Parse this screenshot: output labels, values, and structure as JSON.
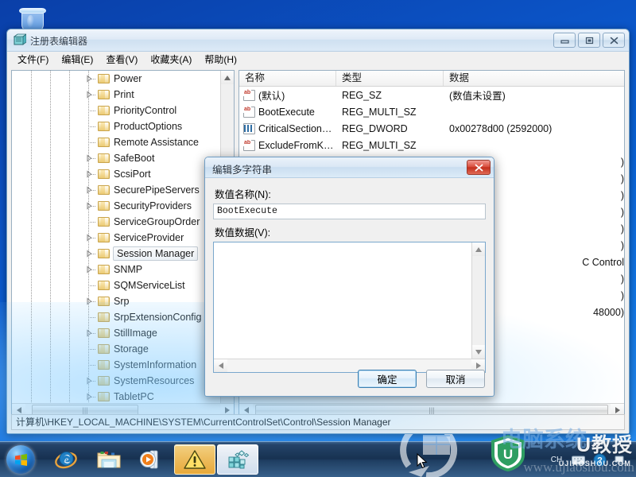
{
  "window": {
    "title": "注册表编辑器",
    "icon": "registry-editor-icon",
    "minimize_label": "最小化",
    "maximize_label": "最大化",
    "close_label": "关闭"
  },
  "menubar": {
    "items": [
      {
        "label": "文件(F)",
        "name": "menu-file"
      },
      {
        "label": "编辑(E)",
        "name": "menu-edit"
      },
      {
        "label": "查看(V)",
        "name": "menu-view"
      },
      {
        "label": "收藏夹(A)",
        "name": "menu-favorites"
      },
      {
        "label": "帮助(H)",
        "name": "menu-help"
      }
    ]
  },
  "tree": {
    "items": [
      {
        "label": "Power",
        "expandable": true,
        "selected": false
      },
      {
        "label": "Print",
        "expandable": true,
        "selected": false
      },
      {
        "label": "PriorityControl",
        "expandable": false,
        "selected": false
      },
      {
        "label": "ProductOptions",
        "expandable": false,
        "selected": false
      },
      {
        "label": "Remote Assistance",
        "expandable": false,
        "selected": false
      },
      {
        "label": "SafeBoot",
        "expandable": true,
        "selected": false
      },
      {
        "label": "ScsiPort",
        "expandable": true,
        "selected": false
      },
      {
        "label": "SecurePipeServers",
        "expandable": true,
        "selected": false
      },
      {
        "label": "SecurityProviders",
        "expandable": true,
        "selected": false
      },
      {
        "label": "ServiceGroupOrder",
        "expandable": false,
        "selected": false
      },
      {
        "label": "ServiceProvider",
        "expandable": true,
        "selected": false
      },
      {
        "label": "Session Manager",
        "expandable": true,
        "selected": true
      },
      {
        "label": "SNMP",
        "expandable": true,
        "selected": false
      },
      {
        "label": "SQMServiceList",
        "expandable": false,
        "selected": false
      },
      {
        "label": "Srp",
        "expandable": true,
        "selected": false
      },
      {
        "label": "SrpExtensionConfig",
        "expandable": false,
        "selected": false
      },
      {
        "label": "StillImage",
        "expandable": true,
        "selected": false
      },
      {
        "label": "Storage",
        "expandable": false,
        "selected": false
      },
      {
        "label": "SystemInformation",
        "expandable": false,
        "selected": false
      },
      {
        "label": "SystemResources",
        "expandable": true,
        "selected": false
      },
      {
        "label": "TabletPC",
        "expandable": true,
        "selected": false
      }
    ]
  },
  "list": {
    "columns": [
      {
        "label": "名称",
        "name": "column-name"
      },
      {
        "label": "类型",
        "name": "column-type"
      },
      {
        "label": "数据",
        "name": "column-data"
      }
    ],
    "rows": [
      {
        "name": "(默认)",
        "type": "REG_SZ",
        "data": "(数值未设置)",
        "icon": "string-value-icon"
      },
      {
        "name": "BootExecute",
        "type": "REG_MULTI_SZ",
        "data": "",
        "icon": "string-value-icon"
      },
      {
        "name": "CriticalSection…",
        "type": "REG_DWORD",
        "data": "0x00278d00 (2592000)",
        "icon": "binary-value-icon"
      },
      {
        "name": "ExcludeFromK…",
        "type": "REG_MULTI_SZ",
        "data": "",
        "icon": "string-value-icon"
      },
      {
        "name": "",
        "type": "",
        "data": ")",
        "icon": ""
      },
      {
        "name": "",
        "type": "",
        "data": ")",
        "icon": ""
      },
      {
        "name": "",
        "type": "",
        "data": ")",
        "icon": ""
      },
      {
        "name": "",
        "type": "",
        "data": ")",
        "icon": ""
      },
      {
        "name": "",
        "type": "",
        "data": ")",
        "icon": ""
      },
      {
        "name": "",
        "type": "",
        "data": ")",
        "icon": ""
      },
      {
        "name": "",
        "type": "",
        "data": "C Control",
        "icon": ""
      },
      {
        "name": "",
        "type": "",
        "data": ")",
        "icon": ""
      },
      {
        "name": "",
        "type": "",
        "data": ")",
        "icon": ""
      },
      {
        "name": "",
        "type": "",
        "data": "48000)",
        "icon": ""
      }
    ]
  },
  "statusbar": {
    "path": "计算机\\HKEY_LOCAL_MACHINE\\SYSTEM\\CurrentControlSet\\Control\\Session Manager"
  },
  "dialog": {
    "title": "编辑多字符串",
    "close_label": "关闭",
    "value_name_label": "数值名称(N):",
    "value_name": "BootExecute",
    "value_data_label": "数值数据(V):",
    "value_data": "",
    "ok_label": "确定",
    "cancel_label": "取消"
  },
  "taskbar": {
    "start_label": "开始",
    "items": [
      {
        "name": "taskbar-internet-explorer",
        "icon": "internet-explorer-icon",
        "state": "pinned"
      },
      {
        "name": "taskbar-windows-explorer",
        "icon": "folder-icon",
        "state": "pinned"
      },
      {
        "name": "taskbar-media-player",
        "icon": "media-player-icon",
        "state": "pinned"
      },
      {
        "name": "taskbar-warning-dialog",
        "icon": "warning-triangle-icon",
        "state": "active"
      },
      {
        "name": "taskbar-registry-editor",
        "icon": "registry-editor-icon",
        "state": "active"
      }
    ],
    "tray": [
      {
        "name": "tray-input-language",
        "label": "CH"
      },
      {
        "name": "tray-keyboard-icon",
        "label": ""
      },
      {
        "name": "tray-help-icon",
        "label": "?"
      },
      {
        "name": "tray-network-icon",
        "label": ""
      }
    ]
  },
  "desktop": {
    "recycle_bin_label": "回收站"
  },
  "watermark": {
    "brand_cn": "U教授",
    "brand_url": "UJIAOSHOU.COM",
    "ghost_text": "www.ujiaoshou.com",
    "ghost_cn": "电脑系统"
  },
  "colors": {
    "desktop_blue": "#0b52c4",
    "window_border": "#6f9dc4",
    "dialog_close_red": "#c32f1d",
    "folder_yellow": "#eccb74",
    "accent_blue": "#3c7fb1"
  }
}
